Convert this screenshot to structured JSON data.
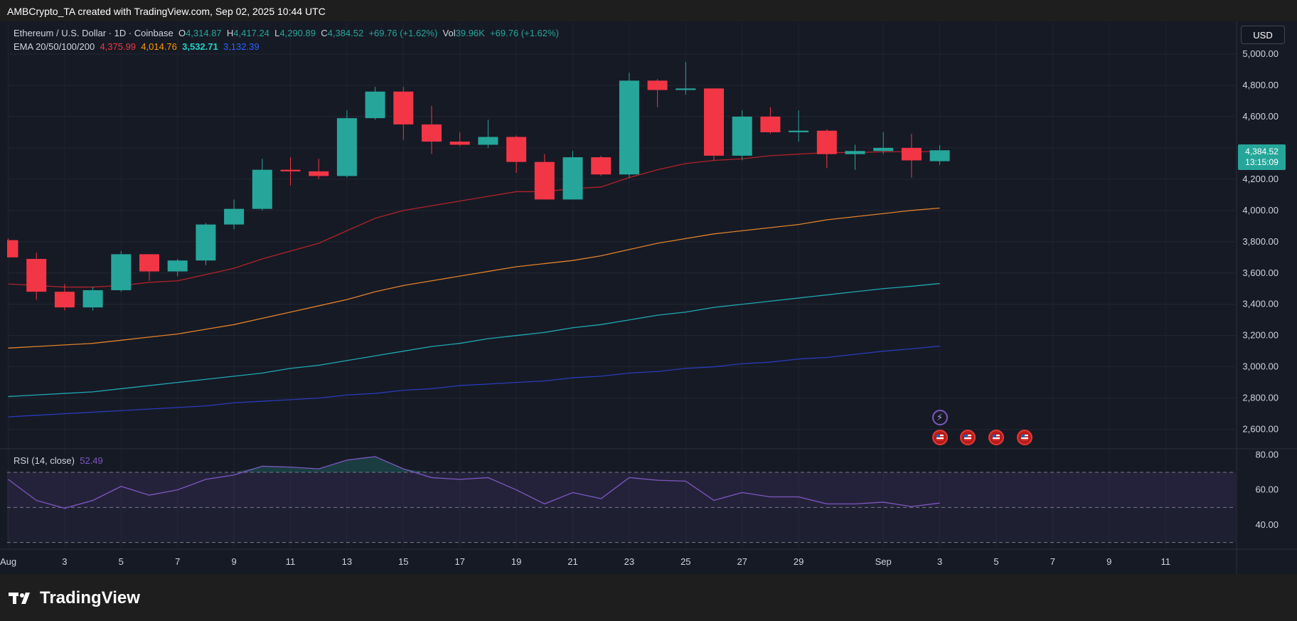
{
  "header": {
    "title": "AMBCrypto_TA created with TradingView.com, Sep 02, 2025 10:44 UTC"
  },
  "legend": {
    "symbol": "Ethereum / U.S. Dollar · 1D · Coinbase",
    "o_label": "O",
    "o_value": "4,314.87",
    "h_label": "H",
    "h_value": "4,417.24",
    "l_label": "L",
    "l_value": "4,290.89",
    "c_label": "C",
    "c_value": "4,384.52",
    "change": "+69.76 (+1.62%)",
    "vol_label": "Vol",
    "vol_value": "39.96K",
    "vol_change": "+69.76 (+1.62%)",
    "ema_label": "EMA 20/50/100/200",
    "ema20": "4,375.99",
    "ema50": "4,014.76",
    "ema100": "3,532.71",
    "ema200": "3,132.39",
    "rsi_label": "RSI (14, close)",
    "rsi_value": "52.49"
  },
  "currency_button": "USD",
  "price_tag": {
    "price": "4,384.52",
    "countdown": "13:15:09"
  },
  "colors": {
    "up": "#26a69a",
    "down": "#f23645",
    "ema20": "#b2222a",
    "ema50": "#e0812a",
    "ema100": "#1fa8b0",
    "ema200": "#2a3bb8",
    "rsi": "#7e57c2"
  },
  "footer": {
    "logo_text": "TradingView"
  },
  "chart_data": {
    "type": "candlestick",
    "price_axis": {
      "ylim": [
        2480,
        5200
      ],
      "ticks": [
        2600,
        2800,
        3000,
        3200,
        3400,
        3600,
        3800,
        4000,
        4200,
        4400,
        4600,
        4800,
        5000
      ],
      "tick_labels": [
        "2,600.00",
        "2,800.00",
        "3,000.00",
        "3,200.00",
        "3,400.00",
        "3,600.00",
        "3,800.00",
        "4,000.00",
        "4,200.00",
        "4,400.00",
        "4,600.00",
        "4,800.00",
        "5,000.00"
      ]
    },
    "x_axis": {
      "tick_index": [
        0,
        2,
        4,
        6,
        8,
        10,
        12,
        14,
        16,
        18,
        20,
        22,
        24,
        26,
        28,
        31,
        33,
        35,
        37,
        39,
        41
      ],
      "tick_labels": [
        "Aug",
        "3",
        "5",
        "7",
        "9",
        "11",
        "13",
        "15",
        "17",
        "19",
        "21",
        "23",
        "25",
        "27",
        "29",
        "Sep",
        "3",
        "5",
        "7",
        "9",
        "11"
      ]
    },
    "candles": [
      {
        "o": 3810,
        "h": 3820,
        "l": 3700,
        "c": 3700
      },
      {
        "o": 3690,
        "h": 3730,
        "l": 3430,
        "c": 3480
      },
      {
        "o": 3480,
        "h": 3530,
        "l": 3360,
        "c": 3380
      },
      {
        "o": 3380,
        "h": 3510,
        "l": 3360,
        "c": 3490
      },
      {
        "o": 3490,
        "h": 3740,
        "l": 3480,
        "c": 3720
      },
      {
        "o": 3720,
        "h": 3720,
        "l": 3550,
        "c": 3610
      },
      {
        "o": 3610,
        "h": 3690,
        "l": 3580,
        "c": 3680
      },
      {
        "o": 3680,
        "h": 3920,
        "l": 3650,
        "c": 3910
      },
      {
        "o": 3910,
        "h": 4070,
        "l": 3880,
        "c": 4010
      },
      {
        "o": 4010,
        "h": 4330,
        "l": 4000,
        "c": 4260
      },
      {
        "o": 4260,
        "h": 4340,
        "l": 4160,
        "c": 4250
      },
      {
        "o": 4250,
        "h": 4330,
        "l": 4200,
        "c": 4220
      },
      {
        "o": 4220,
        "h": 4640,
        "l": 4210,
        "c": 4590
      },
      {
        "o": 4590,
        "h": 4790,
        "l": 4580,
        "c": 4760
      },
      {
        "o": 4760,
        "h": 4790,
        "l": 4450,
        "c": 4550
      },
      {
        "o": 4550,
        "h": 4670,
        "l": 4360,
        "c": 4440
      },
      {
        "o": 4440,
        "h": 4500,
        "l": 4410,
        "c": 4420
      },
      {
        "o": 4420,
        "h": 4580,
        "l": 4400,
        "c": 4470
      },
      {
        "o": 4470,
        "h": 4480,
        "l": 4240,
        "c": 4310
      },
      {
        "o": 4310,
        "h": 4360,
        "l": 4070,
        "c": 4070
      },
      {
        "o": 4070,
        "h": 4380,
        "l": 4070,
        "c": 4340
      },
      {
        "o": 4340,
        "h": 4350,
        "l": 4220,
        "c": 4230
      },
      {
        "o": 4230,
        "h": 4880,
        "l": 4210,
        "c": 4830
      },
      {
        "o": 4830,
        "h": 4840,
        "l": 4660,
        "c": 4770
      },
      {
        "o": 4770,
        "h": 4950,
        "l": 4740,
        "c": 4780
      },
      {
        "o": 4780,
        "h": 4780,
        "l": 4320,
        "c": 4350
      },
      {
        "o": 4350,
        "h": 4640,
        "l": 4320,
        "c": 4600
      },
      {
        "o": 4600,
        "h": 4660,
        "l": 4490,
        "c": 4500
      },
      {
        "o": 4500,
        "h": 4640,
        "l": 4440,
        "c": 4510
      },
      {
        "o": 4510,
        "h": 4520,
        "l": 4270,
        "c": 4360
      },
      {
        "o": 4360,
        "h": 4420,
        "l": 4260,
        "c": 4380
      },
      {
        "o": 4380,
        "h": 4500,
        "l": 4360,
        "c": 4400
      },
      {
        "o": 4400,
        "h": 4490,
        "l": 4210,
        "c": 4320
      },
      {
        "o": 4314.87,
        "h": 4417.24,
        "l": 4290.89,
        "c": 4384.52
      }
    ],
    "ema": [
      {
        "name": "EMA 20",
        "values": [
          3530,
          3520,
          3510,
          3510,
          3520,
          3540,
          3550,
          3590,
          3630,
          3690,
          3740,
          3790,
          3870,
          3950,
          4000,
          4030,
          4060,
          4090,
          4120,
          4120,
          4140,
          4150,
          4210,
          4260,
          4300,
          4320,
          4330,
          4350,
          4360,
          4370,
          4370,
          4375,
          4375,
          4376
        ]
      },
      {
        "name": "EMA 50",
        "values": [
          3120,
          3130,
          3140,
          3150,
          3170,
          3190,
          3210,
          3240,
          3270,
          3310,
          3350,
          3390,
          3430,
          3480,
          3520,
          3550,
          3580,
          3610,
          3640,
          3660,
          3680,
          3710,
          3750,
          3790,
          3820,
          3850,
          3870,
          3890,
          3910,
          3940,
          3960,
          3980,
          4000,
          4015
        ]
      },
      {
        "name": "EMA 100",
        "values": [
          2810,
          2820,
          2830,
          2840,
          2860,
          2880,
          2900,
          2920,
          2940,
          2960,
          2990,
          3010,
          3040,
          3070,
          3100,
          3130,
          3150,
          3180,
          3200,
          3220,
          3250,
          3270,
          3300,
          3330,
          3350,
          3380,
          3400,
          3420,
          3440,
          3460,
          3480,
          3500,
          3515,
          3532.71
        ]
      },
      {
        "name": "EMA 200",
        "values": [
          2680,
          2690,
          2700,
          2710,
          2720,
          2730,
          2740,
          2750,
          2770,
          2780,
          2790,
          2800,
          2820,
          2830,
          2850,
          2860,
          2880,
          2890,
          2900,
          2910,
          2930,
          2940,
          2960,
          2970,
          2990,
          3000,
          3020,
          3030,
          3050,
          3060,
          3080,
          3100,
          3115,
          3132.39
        ]
      }
    ],
    "rsi": {
      "ylim": [
        27,
        83
      ],
      "ticks": [
        40,
        60,
        80
      ],
      "tick_labels": [
        "40.00",
        "60.00",
        "80.00"
      ],
      "band": [
        50,
        70
      ],
      "overbought": 70,
      "oversold": 30,
      "values": [
        66,
        54,
        49.5,
        54,
        62,
        57,
        60,
        66,
        68.5,
        73.5,
        73,
        72,
        77,
        79,
        72,
        67,
        66,
        67,
        60,
        52,
        58.5,
        55,
        67,
        65.5,
        65,
        54,
        58.5,
        56,
        56,
        52,
        52,
        53,
        50.5,
        52.49
      ]
    },
    "events": [
      {
        "index": 33,
        "icon": "lightning-icon"
      },
      {
        "index": 33,
        "icon": "us-flag-icon"
      },
      {
        "index": 34,
        "icon": "us-flag-icon"
      },
      {
        "index": 35,
        "icon": "us-flag-icon"
      },
      {
        "index": 36,
        "icon": "us-flag-icon"
      }
    ]
  }
}
